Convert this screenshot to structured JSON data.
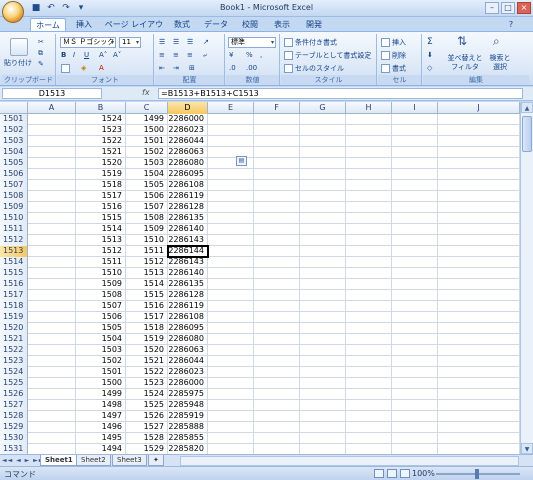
{
  "window": {
    "title": "Book1 - Microsoft Excel"
  },
  "tabs": [
    "ホーム",
    "挿入",
    "ページ レイアウト",
    "数式",
    "データ",
    "校閲",
    "表示",
    "開発"
  ],
  "ribbon": {
    "paste": "貼り付け",
    "clipboard": "クリップボード",
    "font_name": "ＭＳ Ｐゴシック",
    "font_size": "11",
    "font_group": "フォント",
    "align_group": "配置",
    "number_format": "標準",
    "number_group": "数値",
    "cond_format": "条件付き書式",
    "table_format": "テーブルとして書式設定",
    "cell_style": "セルのスタイル",
    "style_group": "スタイル",
    "insert": "挿入",
    "delete": "削除",
    "format": "書式",
    "cells_group": "セル",
    "sort_filter": "並べ替えと フィルタ",
    "find_select": "検索と 選択",
    "edit_group": "編集"
  },
  "formula_bar": {
    "name_box": "D1513",
    "fx": "fx",
    "formula": "=B1513+B1513+C1513"
  },
  "columns": [
    "A",
    "B",
    "C",
    "D",
    "E",
    "F",
    "G",
    "H",
    "I",
    "J"
  ],
  "rows": [
    {
      "r": "1501",
      "b": "1524",
      "c": "1499",
      "d": "2286000"
    },
    {
      "r": "1502",
      "b": "1523",
      "c": "1500",
      "d": "2286023"
    },
    {
      "r": "1503",
      "b": "1522",
      "c": "1501",
      "d": "2286044"
    },
    {
      "r": "1504",
      "b": "1521",
      "c": "1502",
      "d": "2286063"
    },
    {
      "r": "1505",
      "b": "1520",
      "c": "1503",
      "d": "2286080"
    },
    {
      "r": "1506",
      "b": "1519",
      "c": "1504",
      "d": "2286095"
    },
    {
      "r": "1507",
      "b": "1518",
      "c": "1505",
      "d": "2286108"
    },
    {
      "r": "1508",
      "b": "1517",
      "c": "1506",
      "d": "2286119"
    },
    {
      "r": "1509",
      "b": "1516",
      "c": "1507",
      "d": "2286128"
    },
    {
      "r": "1510",
      "b": "1515",
      "c": "1508",
      "d": "2286135"
    },
    {
      "r": "1511",
      "b": "1514",
      "c": "1509",
      "d": "2286140"
    },
    {
      "r": "1512",
      "b": "1513",
      "c": "1510",
      "d": "2286143"
    },
    {
      "r": "1513",
      "b": "1512",
      "c": "1511",
      "d": "2286144"
    },
    {
      "r": "1514",
      "b": "1511",
      "c": "1512",
      "d": "2286143"
    },
    {
      "r": "1515",
      "b": "1510",
      "c": "1513",
      "d": "2286140"
    },
    {
      "r": "1516",
      "b": "1509",
      "c": "1514",
      "d": "2286135"
    },
    {
      "r": "1517",
      "b": "1508",
      "c": "1515",
      "d": "2286128"
    },
    {
      "r": "1518",
      "b": "1507",
      "c": "1516",
      "d": "2286119"
    },
    {
      "r": "1519",
      "b": "1506",
      "c": "1517",
      "d": "2286108"
    },
    {
      "r": "1520",
      "b": "1505",
      "c": "1518",
      "d": "2286095"
    },
    {
      "r": "1521",
      "b": "1504",
      "c": "1519",
      "d": "2286080"
    },
    {
      "r": "1522",
      "b": "1503",
      "c": "1520",
      "d": "2286063"
    },
    {
      "r": "1523",
      "b": "1502",
      "c": "1521",
      "d": "2286044"
    },
    {
      "r": "1524",
      "b": "1501",
      "c": "1522",
      "d": "2286023"
    },
    {
      "r": "1525",
      "b": "1500",
      "c": "1523",
      "d": "2286000"
    },
    {
      "r": "1526",
      "b": "1499",
      "c": "1524",
      "d": "2285975"
    },
    {
      "r": "1527",
      "b": "1498",
      "c": "1525",
      "d": "2285948"
    },
    {
      "r": "1528",
      "b": "1497",
      "c": "1526",
      "d": "2285919"
    },
    {
      "r": "1529",
      "b": "1496",
      "c": "1527",
      "d": "2285888"
    },
    {
      "r": "1530",
      "b": "1495",
      "c": "1528",
      "d": "2285855"
    },
    {
      "r": "1531",
      "b": "1494",
      "c": "1529",
      "d": "2285820"
    }
  ],
  "selected_row": "1513",
  "sheets": [
    "Sheet1",
    "Sheet2",
    "Sheet3"
  ],
  "status": {
    "mode": "コマンド",
    "zoom": "100%"
  }
}
